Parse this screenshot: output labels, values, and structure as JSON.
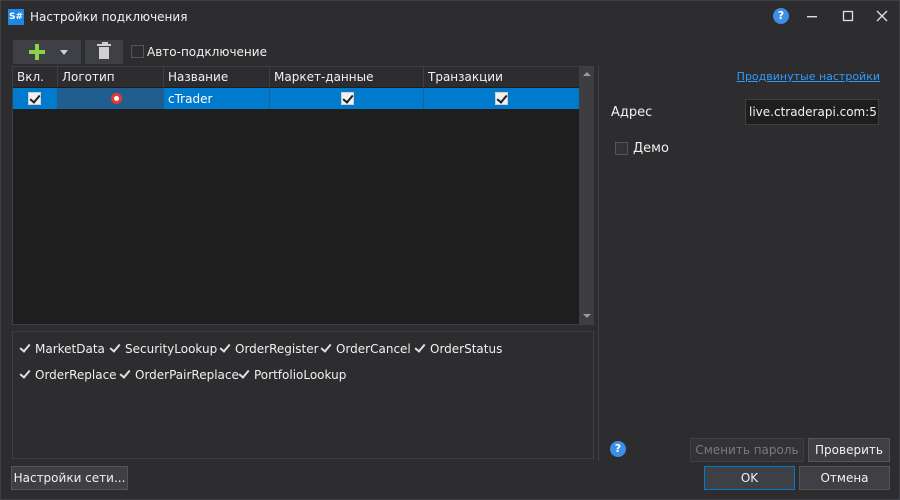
{
  "window": {
    "app_icon": "S#",
    "title": "Настройки подключения",
    "help_icon": "?",
    "minimize_icon": "minimize-icon",
    "maximize_icon": "maximize-icon",
    "close_icon": "close-icon"
  },
  "toolbar": {
    "add_icon": "plus-icon",
    "delete_icon": "trash-icon",
    "auto_connect_label": "Авто-подключение",
    "auto_connect_checked": false
  },
  "grid": {
    "columns": [
      "Вкл.",
      "Логотип",
      "Название",
      "Маркет-данные",
      "Транзакции"
    ],
    "rows": [
      {
        "enabled": true,
        "logo": "ctrader-logo-icon",
        "name": "cTrader",
        "market_data": true,
        "transactions": true,
        "selected": true
      }
    ]
  },
  "capabilities": [
    "MarketData",
    "SecurityLookup",
    "OrderRegister",
    "OrderCancel",
    "OrderStatus",
    "OrderReplace",
    "OrderPairReplace",
    "PortfolioLookup"
  ],
  "settings": {
    "advanced_link": "Продвинутые настройки",
    "address_label": "Адрес",
    "address_value": "live.ctraderapi.com:5",
    "demo_label": "Демо",
    "demo_checked": false,
    "help_icon": "?"
  },
  "buttons": {
    "change_password": "Сменить пароль",
    "check": "Проверить",
    "network_settings": "Настройки сети...",
    "ok": "OK",
    "cancel": "Отмена"
  },
  "colors": {
    "background": "#2d2d30",
    "selection": "#007acc",
    "link": "#3399ff",
    "plus": "#8bd44a"
  }
}
